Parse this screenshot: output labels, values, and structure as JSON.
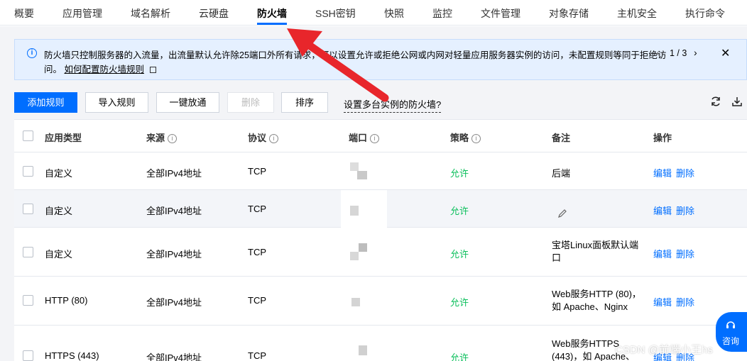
{
  "tabs": [
    {
      "label": "概要"
    },
    {
      "label": "应用管理"
    },
    {
      "label": "域名解析"
    },
    {
      "label": "云硬盘"
    },
    {
      "label": "防火墙"
    },
    {
      "label": "SSH密钥"
    },
    {
      "label": "快照"
    },
    {
      "label": "监控"
    },
    {
      "label": "文件管理"
    },
    {
      "label": "对象存储"
    },
    {
      "label": "主机安全"
    },
    {
      "label": "执行命令"
    }
  ],
  "active_tab": "防火墙",
  "notice": {
    "line1": "防火墙只控制服务器的入流量，出流量默认允许除25端口外所有请求，可以设置允许或拒绝公网或内网对轻量应用服务器实例的访问，未配置规则等同于拒绝访",
    "line2_prefix": "问。",
    "link": "如何配置防火墙规则",
    "pager": "1 / 3"
  },
  "toolbar": {
    "add": "添加规则",
    "import": "导入规则",
    "open_all": "一键放通",
    "delete": "删除",
    "sort": "排序",
    "multi": "设置多台实例的防火墙?"
  },
  "table": {
    "headers": {
      "app_type": "应用类型",
      "source": "来源",
      "protocol": "协议",
      "port": "端口",
      "policy": "策略",
      "note": "备注",
      "action": "操作"
    },
    "rows": [
      {
        "app_type": "自定义",
        "source": "全部IPv4地址",
        "protocol": "TCP",
        "policy": "允许",
        "note": "后端"
      },
      {
        "app_type": "自定义",
        "source": "全部IPv4地址",
        "protocol": "TCP",
        "policy": "允许",
        "note": ""
      },
      {
        "app_type": "自定义",
        "source": "全部IPv4地址",
        "protocol": "TCP",
        "policy": "允许",
        "note": "宝塔Linux面板默认端口"
      },
      {
        "app_type": "HTTP (80)",
        "source": "全部IPv4地址",
        "protocol": "TCP",
        "policy": "允许",
        "note": "Web服务HTTP (80)，如 Apache、Nginx"
      },
      {
        "app_type": "HTTPS (443)",
        "source": "全部IPv4地址",
        "protocol": "TCP",
        "policy": "允许",
        "note": "Web服务HTTPS (443)，如 Apache、"
      }
    ],
    "edit_label": "编辑",
    "delete_label": "删除"
  },
  "consult": {
    "label": "咨询"
  },
  "watermark": "CSDN @前端小王hs",
  "colors": {
    "primary": "#006eff",
    "allow": "#0abf5b",
    "arrow": "#e8262b"
  }
}
